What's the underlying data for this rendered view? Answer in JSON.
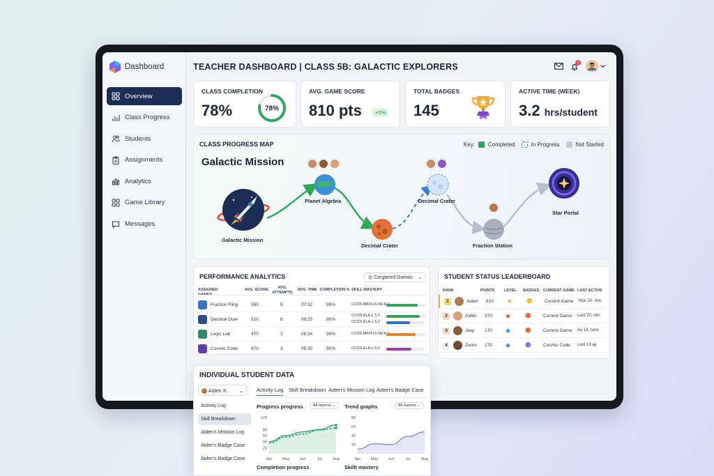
{
  "sidebar": {
    "brand": "Dashboard",
    "items": [
      {
        "label": "Overview",
        "icon": "grid-icon"
      },
      {
        "label": "Class Progress",
        "icon": "bar-chart-icon"
      },
      {
        "label": "Students",
        "icon": "users-icon"
      },
      {
        "label": "Assignments",
        "icon": "clipboard-icon"
      },
      {
        "label": "Analytics",
        "icon": "analytics-icon"
      },
      {
        "label": "Game Library",
        "icon": "library-icon"
      },
      {
        "label": "Messages",
        "icon": "message-icon"
      }
    ]
  },
  "header": {
    "title": "TEACHER DASHBOARD | CLASS 5B: GALACTIC EXPLORERS",
    "notification_count": "1"
  },
  "kpis": {
    "completion": {
      "label": "CLASS COMPLETION",
      "value": "78%",
      "ring_text": "78%",
      "ring_fraction": 0.78
    },
    "score": {
      "label": "AVG. GAME SCORE",
      "value": "810 pts",
      "delta": "+5%"
    },
    "badges": {
      "label": "TOTAL BADGES",
      "value": "145"
    },
    "time": {
      "label": "ACTIVE TIME (WEEK)",
      "value": "3.2",
      "unit": "hrs/student"
    }
  },
  "progress_map": {
    "title": "CLASS PROGRESS MAP",
    "key_label": "Key:",
    "key": [
      "Completed",
      "In Progress",
      "Not Started"
    ],
    "mission_title": "Galactic Mission",
    "nodes": [
      "Galactic Mission",
      "Planet Algebra",
      "Decimal Crater",
      "Decimal Crater",
      "Fraction Station",
      "Star Portal"
    ]
  },
  "performance": {
    "title": "PERFORMANCE ANALYTICS",
    "filter": "Corgtered Games",
    "columns": [
      "ASSIGNED GAMES",
      "AVG. SCORE",
      "AVG. ATTEMPTS",
      "AVG. TIME",
      "COMPLETION %",
      "SKILL MASTERY"
    ],
    "rows": [
      {
        "game": "Fraction Fling",
        "score": "550",
        "attempts": "5",
        "time": "07:32",
        "completion": "90%",
        "skills": [
          "CCSS.MATH.5.NF.A.1"
        ]
      },
      {
        "game": "Decimal Duel",
        "score": "510",
        "attempts": "6",
        "time": "09:25",
        "completion": "90%",
        "skills": [
          "CCSS.ELA.L.5.2",
          "CCSS.ELA.L.5.2"
        ]
      },
      {
        "game": "Logic Lab",
        "score": "470",
        "attempts": "2",
        "time": "08:34",
        "completion": "90%",
        "skills": [
          "CCSS.MATH.5.NF.A.1"
        ]
      },
      {
        "game": "Cosmic Code",
        "score": "470",
        "attempts": "3",
        "time": "05:30",
        "completion": "90%",
        "skills": [
          "CCSS.ELA.L.5.2"
        ]
      }
    ],
    "mastery": [
      [
        {
          "color": "#2fa65a",
          "fraction": 0.8
        }
      ],
      [
        {
          "color": "#2fa65a",
          "fraction": 0.85
        },
        {
          "color": "#2f6fd6",
          "fraction": 0.6
        }
      ],
      [
        {
          "color": "#e3862a",
          "fraction": 0.75
        }
      ],
      [
        {
          "color": "#9b3fa6",
          "fraction": 0.65
        }
      ]
    ]
  },
  "leaderboard": {
    "title": "STUDENT STATUS LEADERBOARD",
    "columns": [
      "RANK",
      "POINTS",
      "LEVEL",
      "BADGES",
      "CURRENT GAME",
      "LAST ACTIVE"
    ],
    "rows": [
      {
        "rank": "1",
        "name": "Aiden",
        "points": "810",
        "game": "Current Game",
        "last": "Nov 10, min"
      },
      {
        "rank": "2",
        "name": "Aiden",
        "points": "370",
        "game": "Current Game",
        "last": "Last 70, min"
      },
      {
        "rank": "3",
        "name": "Jaxy",
        "points": "170",
        "game": "Current Game",
        "last": "Au 18, tune"
      },
      {
        "rank": "4",
        "name": "Zeom",
        "points": "170",
        "game": "Cosmic Code",
        "last": "Last 13.ay"
      }
    ]
  },
  "student": {
    "title": "INDIVIDUAL STUDENT DATA",
    "selected": "Aiden K.",
    "nav": [
      "Activity Log",
      "Skill Breakdown",
      "Aiden's Mission Log",
      "Aiden's Badge Case",
      "Aiden's Badge Case"
    ],
    "tabs": [
      "Activity Log",
      "Skill Breakdown",
      "Aiden's Mission Log",
      "Aiden's Badge Case"
    ],
    "chart1": {
      "title": "Progress progress",
      "filter": "All regress",
      "yticks": [
        "120",
        "80",
        "60",
        "40",
        "20"
      ],
      "xticks": [
        "Apr",
        "May",
        "Jun",
        "Jul",
        "Aug"
      ]
    },
    "chart2": {
      "title": "Trend graphs",
      "filter": "All regress",
      "yticks": [
        "80",
        "60",
        "40",
        "20"
      ],
      "xticks": [
        "Apr",
        "May",
        "Jun",
        "Jul",
        "Aug"
      ]
    },
    "footer_left": "Completion progress",
    "footer_right": "Skillt mastery"
  },
  "chart_data": [
    {
      "type": "area",
      "title": "Progress progress",
      "categories": [
        "Apr",
        "May",
        "Jun",
        "Jul",
        "Aug"
      ],
      "ylim": [
        0,
        120
      ],
      "series": [
        {
          "values": [
            40,
            60,
            72,
            80,
            95
          ]
        },
        {
          "values": [
            35,
            55,
            65,
            78,
            85
          ]
        }
      ]
    },
    {
      "type": "area",
      "title": "Trend graphs",
      "categories": [
        "Apr",
        "May",
        "Jun",
        "Jul",
        "Aug"
      ],
      "ylim": [
        0,
        80
      ],
      "series": [
        {
          "values": [
            10,
            22,
            20,
            38,
            48
          ]
        }
      ]
    }
  ]
}
